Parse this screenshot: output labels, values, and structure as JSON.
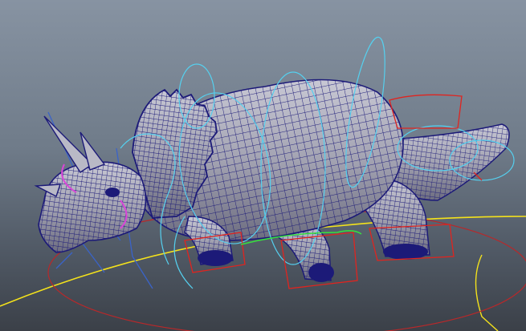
{
  "viewport": {
    "background_top": "#8793a2",
    "background_bottom": "#3b4048"
  },
  "scene": {
    "model": "triceratops",
    "display_mode": "wireframe-on-shaded"
  },
  "colors": {
    "wireframe": "#1c1a78",
    "skin": "#a7a6b5",
    "rig_curves": "#55d0ef",
    "ik_controls": "#e0241f",
    "ground_grid": "#f4e21b",
    "selected_joint": "#d946d8",
    "root_circle": "#b8282a",
    "green_control": "#36e23e",
    "joint_lines": "#3a63c9"
  }
}
